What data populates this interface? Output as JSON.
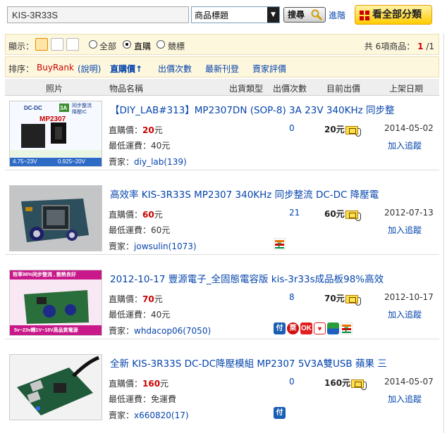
{
  "search": {
    "query": "KIS-3R33S",
    "category": "商品標題",
    "button": "搜尋",
    "advanced": "進階",
    "all_categories": "看全部分類"
  },
  "display": {
    "label": "顯示：",
    "filters": [
      "全部",
      "直購",
      "競標"
    ],
    "selected": "直購",
    "count_prefix": "共",
    "count": "6",
    "count_suffix": "項商品：",
    "page_current": "1",
    "page_total": "/1"
  },
  "sort": {
    "label": "排序：",
    "options": [
      "BuyRank",
      "(說明)",
      "直購價↑",
      "出價次數",
      "最新刊登",
      "賣家評價"
    ]
  },
  "columns": [
    "照片",
    "物品名稱",
    "出貨類型",
    "出價次數",
    "目前出價",
    "上架日期"
  ],
  "items": [
    {
      "title": "【DIY_LAB#313】MP2307DN (SOP-8) 3A 23V 340KHz 同步整",
      "price_label": "直購價：",
      "price": "20",
      "price_unit": "元",
      "shipping": "最低運費：40元",
      "seller_label": "賣家：",
      "seller": "diy_lab(139)",
      "bids": "0",
      "current_price": "20元",
      "date": "2014-05-02",
      "track": "加入追蹤",
      "thumb_text": [
        "DC-DC",
        "3A",
        "同步整流",
        "降壓IC",
        "MP2307",
        "4.75~23V",
        "0.925~20V"
      ]
    },
    {
      "title": "高效率 KIS-3R33S MP2307 340KHz 同步整流 DC-DC 降壓電",
      "price_label": "直購價：",
      "price": "60",
      "price_unit": "元",
      "shipping": "最低運費：60元",
      "seller_label": "賣家：",
      "seller": "jowsulin(1073)",
      "bids": "21",
      "current_price": "60元",
      "date": "2012-07-13",
      "track": "加入追蹤"
    },
    {
      "title": "2012-10-17 豐源電子_全固態電容版 kis-3r33s成品板98%高效",
      "price_label": "直購價：",
      "price": "70",
      "price_unit": "元",
      "shipping": "最低運費：40元",
      "seller_label": "賣家：",
      "seller": "whdacop06(7050)",
      "bids": "8",
      "current_price": "70元",
      "date": "2012-10-17",
      "track": "加入追蹤",
      "thumb_text": [
        "效率98%同步整流 , 散熱良好",
        "5v~23v轉1V~18V高品質電源"
      ]
    },
    {
      "title": "全新 KIS-3R33S DC-DC降壓模組 MP2307 5V3A雙USB 蘋果 三",
      "price_label": "直購價：",
      "price": "160",
      "price_unit": "元",
      "shipping": "最低運費：免運費",
      "seller_label": "賣家：",
      "seller": "x660820(17)",
      "bids": "0",
      "current_price": "160元",
      "date": "2014-05-07",
      "track": "加入追蹤"
    }
  ],
  "colors": {
    "link": "#0645ad",
    "price": "#cc0000",
    "toolbar_bg": "#fdf7dd",
    "all_cat_bg": "#ffcc00"
  }
}
